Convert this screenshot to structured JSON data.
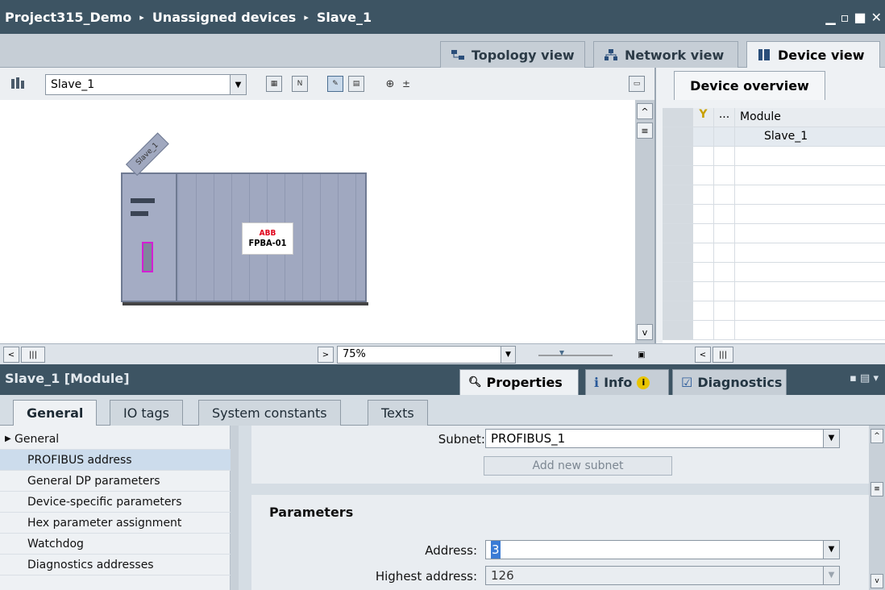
{
  "titlebar": {
    "crumbs": [
      "Project315_Demo",
      "Unassigned devices",
      "Slave_1"
    ],
    "separator": "▸"
  },
  "view_tabs": [
    {
      "label": "Topology view",
      "icon": "topology-icon"
    },
    {
      "label": "Network view",
      "icon": "network-icon"
    },
    {
      "label": "Device view",
      "icon": "device-icon"
    }
  ],
  "toolbar": {
    "device_select": "Slave_1"
  },
  "canvas": {
    "device_tag": "Slave_1",
    "module_brand": "ABB",
    "module_name": "FPBA-01",
    "zoom": "75%"
  },
  "overview": {
    "tab": "Device overview",
    "col_dots": "...",
    "col_module": "Module",
    "rows": [
      {
        "module": "Slave_1"
      }
    ]
  },
  "inspector": {
    "title": "Slave_1 [Module]",
    "tabs": [
      "Properties",
      "Info",
      "Diagnostics"
    ],
    "subtabs": [
      "General",
      "IO tags",
      "System constants",
      "Texts"
    ]
  },
  "nav": {
    "items": [
      {
        "label": "General",
        "expander": true
      },
      {
        "label": "PROFIBUS address",
        "selected": true
      },
      {
        "label": "General DP parameters"
      },
      {
        "label": "Device-specific parameters"
      },
      {
        "label": "Hex parameter assignment"
      },
      {
        "label": "Watchdog"
      },
      {
        "label": "Diagnostics addresses"
      }
    ]
  },
  "form": {
    "subnet_label": "Subnet:",
    "subnet_value": "PROFIBUS_1",
    "add_subnet_label": "Add new subnet",
    "params_title": "Parameters",
    "address_label": "Address:",
    "address_value": "3",
    "highest_label": "Highest address:",
    "highest_value": "126"
  },
  "colors": {
    "titlebar": "#3d5463",
    "selection": "#ccdcec",
    "module_highlight": "#d31fd3"
  }
}
